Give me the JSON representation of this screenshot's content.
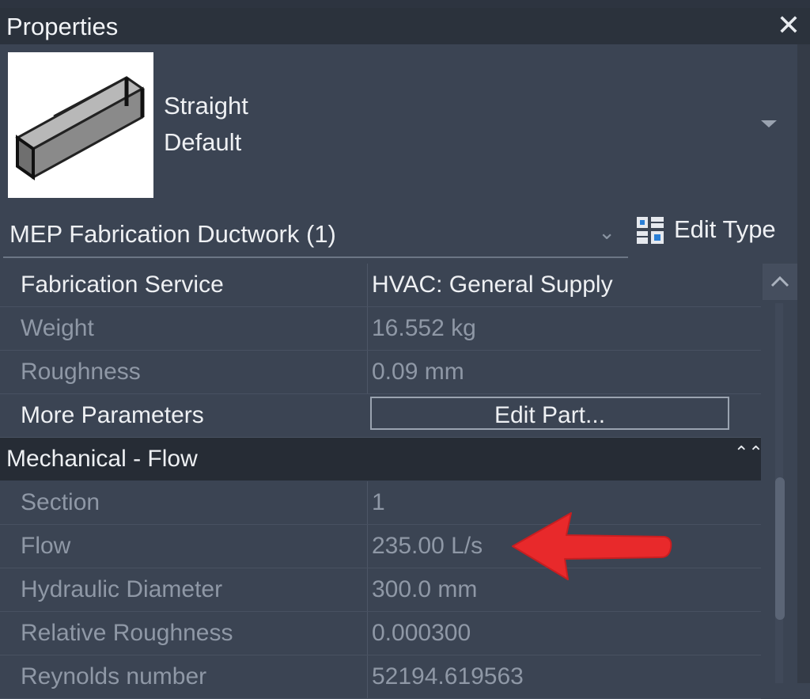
{
  "window": {
    "title": "Properties",
    "close_icon": "close-icon"
  },
  "type_selector": {
    "name": "Straight",
    "subtype": "Default",
    "thumbnail_icon": "straight-duct-icon",
    "dropdown_icon": "triangle-down-icon"
  },
  "filter": {
    "label": "MEP Fabrication Ductwork (1)",
    "chevron": "⌄",
    "edit_type_label": "Edit Type",
    "edit_type_icon": "edit-type-icon"
  },
  "parameters": {
    "rows": [
      {
        "label": "Fabrication Service",
        "value": "HVAC: General Supply",
        "state": "active"
      },
      {
        "label": "Weight",
        "value": "16.552 kg",
        "state": "muted"
      },
      {
        "label": "Roughness",
        "value": "0.09 mm",
        "state": "muted"
      },
      {
        "label": "More Parameters",
        "button_label": "Edit Part...",
        "state": "active"
      }
    ]
  },
  "group": {
    "title": "Mechanical - Flow",
    "collapse_icon": "double-chevron-up-icon",
    "collapse_glyph": "⌃⌃",
    "rows": [
      {
        "label": "Section",
        "value": "1"
      },
      {
        "label": "Flow",
        "value": "235.00 L/s"
      },
      {
        "label": "Hydraulic Diameter",
        "value": "300.0 mm"
      },
      {
        "label": "Relative Roughness",
        "value": "0.000300"
      },
      {
        "label": "Reynolds number",
        "value": "52194.619563"
      }
    ]
  },
  "annotation": {
    "arrow_icon": "red-arrow-icon",
    "color": "#e8292b"
  },
  "colors": {
    "panel_bg": "#3b4453",
    "titlebar_bg": "#2b323c",
    "group_header_bg": "#262c35",
    "text_active": "#eef0f3",
    "text_muted": "#8f98a6"
  }
}
